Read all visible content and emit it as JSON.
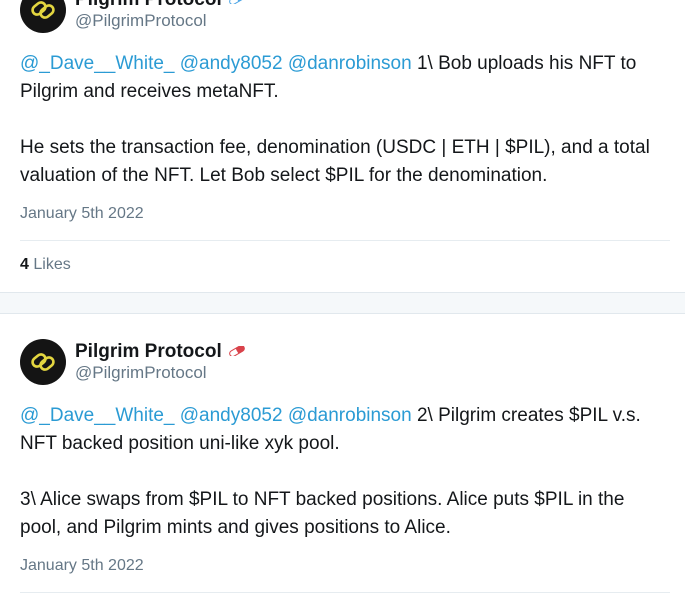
{
  "colors": {
    "mention": "#2b9bd4",
    "muted": "#657786",
    "text": "#14171a",
    "avatar_bg": "#141414",
    "logo_yellow": "#e3d640"
  },
  "tweets": [
    {
      "author": {
        "name": "Pilgrim Protocol",
        "handle": "@PilgrimProtocol",
        "badge_icon": "pill-icon-blue"
      },
      "mentions": [
        "@_Dave__White_",
        "@andy8052",
        "@danrobinson"
      ],
      "paragraph1_rest": " 1\\ Bob uploads his NFT to Pilgrim and receives metaNFT.",
      "paragraph2": "He sets the transaction fee, denomination (USDC | ETH | $PIL), and a total valuation of the NFT. Let Bob select $PIL for the denomination.",
      "date": "January 5th 2022",
      "likes_count": "4",
      "likes_label": "Likes"
    },
    {
      "author": {
        "name": "Pilgrim Protocol",
        "handle": "@PilgrimProtocol",
        "badge_icon": "pill-icon-red"
      },
      "mentions": [
        "@_Dave__White_",
        "@andy8052",
        "@danrobinson"
      ],
      "paragraph1_rest": " 2\\ Pilgrim creates $PIL v.s. NFT backed position uni-like xyk pool.",
      "paragraph2": "3\\ Alice swaps from $PIL to NFT backed positions. Alice puts $PIL in the pool, and Pilgrim mints and gives positions to Alice.",
      "date": "January 5th 2022"
    }
  ]
}
